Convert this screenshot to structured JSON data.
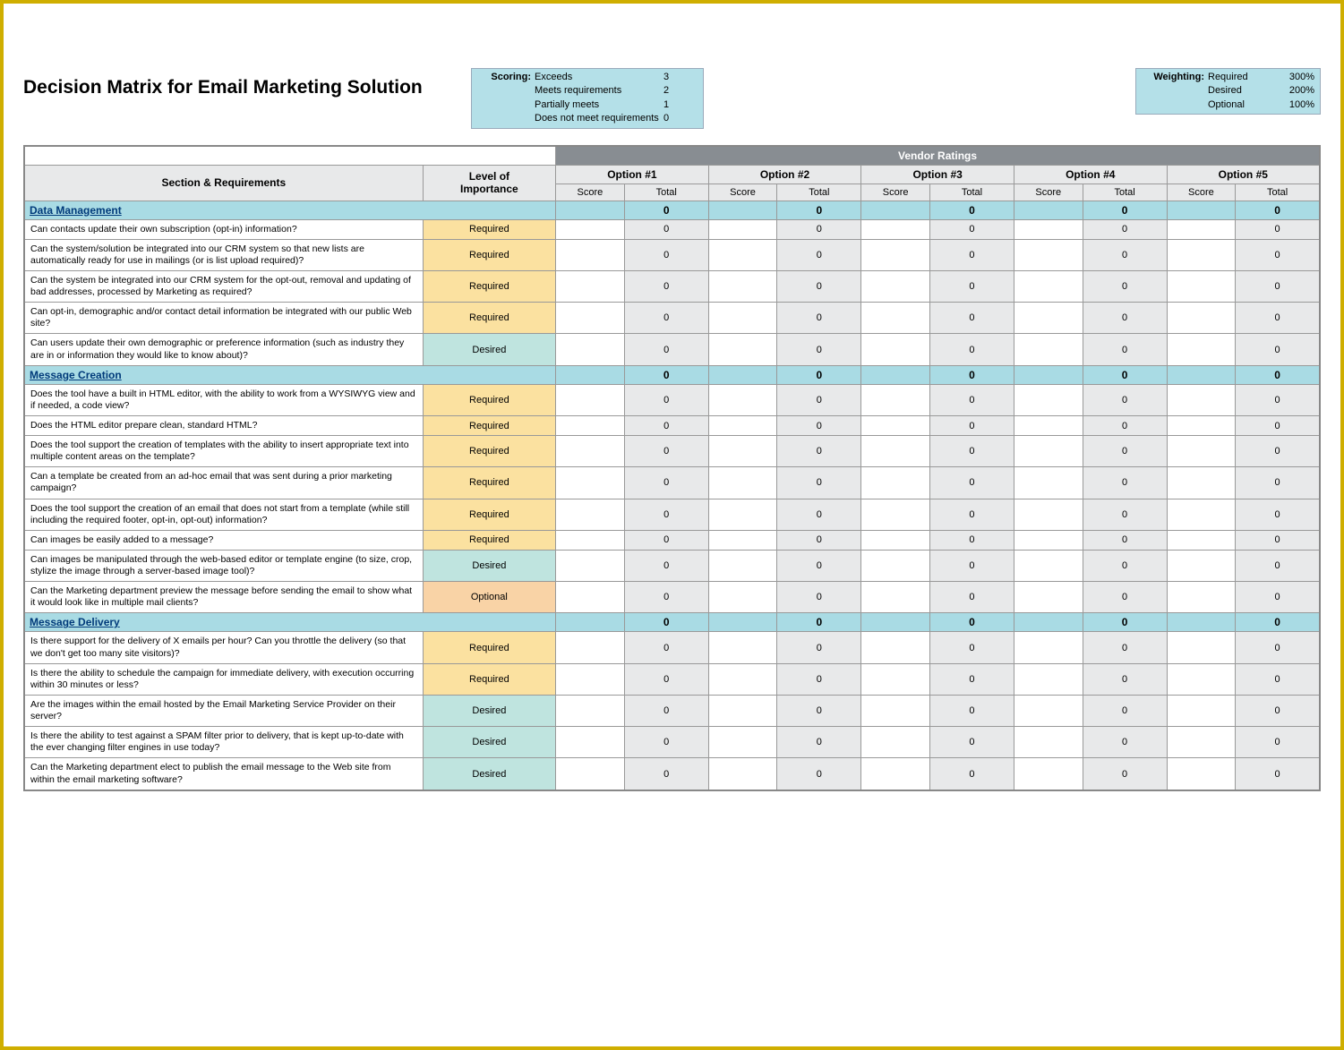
{
  "title": "Decision Matrix for Email Marketing Solution",
  "scoring": {
    "label": "Scoring:",
    "rows": [
      {
        "text": "Exceeds",
        "value": "3"
      },
      {
        "text": "Meets requirements",
        "value": "2"
      },
      {
        "text": "Partially meets",
        "value": "1"
      },
      {
        "text": "Does not meet requirements",
        "value": "0"
      }
    ]
  },
  "weighting": {
    "label": "Weighting:",
    "rows": [
      {
        "text": "Required",
        "value": "300%"
      },
      {
        "text": "Desired",
        "value": "200%"
      },
      {
        "text": "Optional",
        "value": "100%"
      }
    ]
  },
  "headers": {
    "vendor_ratings": "Vendor Ratings",
    "section_requirements": "Section & Requirements",
    "level_of_importance": "Level of\nImportance",
    "options": [
      "Option #1",
      "Option #2",
      "Option #3",
      "Option #4",
      "Option #5"
    ],
    "score": "Score",
    "total": "Total"
  },
  "sections": [
    {
      "name": "Data Management",
      "totals": [
        "0",
        "0",
        "0",
        "0",
        "0"
      ],
      "rows": [
        {
          "text": "Can contacts update their own subscription (opt-in) information?",
          "level": "Required",
          "totals": [
            "0",
            "0",
            "0",
            "0",
            "0"
          ]
        },
        {
          "text": "Can the system/solution be integrated into our CRM system so that new lists are automatically ready for use in mailings (or is list upload required)?",
          "level": "Required",
          "totals": [
            "0",
            "0",
            "0",
            "0",
            "0"
          ]
        },
        {
          "text": "Can the system be integrated into our CRM system for the opt-out, removal and updating of bad addresses, processed by Marketing as required?",
          "level": "Required",
          "totals": [
            "0",
            "0",
            "0",
            "0",
            "0"
          ]
        },
        {
          "text": "Can opt-in, demographic and/or contact detail information be integrated with our public Web site?",
          "level": "Required",
          "totals": [
            "0",
            "0",
            "0",
            "0",
            "0"
          ]
        },
        {
          "text": "Can users update their own demographic or preference information (such as industry they are in or information they would like to know about)?",
          "level": "Desired",
          "totals": [
            "0",
            "0",
            "0",
            "0",
            "0"
          ]
        }
      ]
    },
    {
      "name": "Message Creation",
      "totals": [
        "0",
        "0",
        "0",
        "0",
        "0"
      ],
      "rows": [
        {
          "text": "Does the tool have a built in HTML editor, with the ability to work from a WYSIWYG view and if needed, a code view?",
          "level": "Required",
          "totals": [
            "0",
            "0",
            "0",
            "0",
            "0"
          ]
        },
        {
          "text": "Does the HTML editor prepare clean, standard HTML?",
          "level": "Required",
          "totals": [
            "0",
            "0",
            "0",
            "0",
            "0"
          ]
        },
        {
          "text": "Does the tool support the creation of templates with the ability to insert appropriate text into multiple content areas on the template?",
          "level": "Required",
          "totals": [
            "0",
            "0",
            "0",
            "0",
            "0"
          ]
        },
        {
          "text": "Can a template be created from an ad-hoc email that was sent during a prior marketing campaign?",
          "level": "Required",
          "totals": [
            "0",
            "0",
            "0",
            "0",
            "0"
          ]
        },
        {
          "text": "Does the tool support the creation of an email that does not start from a template (while still including the required footer, opt-in, opt-out) information?",
          "level": "Required",
          "totals": [
            "0",
            "0",
            "0",
            "0",
            "0"
          ]
        },
        {
          "text": "Can images be easily added to a message?",
          "level": "Required",
          "totals": [
            "0",
            "0",
            "0",
            "0",
            "0"
          ]
        },
        {
          "text": "Can images be manipulated through the web-based editor or template engine (to size, crop, stylize the image through a server-based image tool)?",
          "level": "Desired",
          "totals": [
            "0",
            "0",
            "0",
            "0",
            "0"
          ]
        },
        {
          "text": "Can the Marketing department preview the message before sending the email to show what it would look like in multiple mail clients?",
          "level": "Optional",
          "totals": [
            "0",
            "0",
            "0",
            "0",
            "0"
          ]
        }
      ]
    },
    {
      "name": "Message Delivery",
      "totals": [
        "0",
        "0",
        "0",
        "0",
        "0"
      ],
      "rows": [
        {
          "text": "Is there support for the delivery of X emails per hour?  Can you throttle the delivery (so that we don't get too many site visitors)?",
          "level": "Required",
          "totals": [
            "0",
            "0",
            "0",
            "0",
            "0"
          ]
        },
        {
          "text": "Is there the ability to schedule the campaign for immediate delivery, with execution occurring within 30 minutes or less?",
          "level": "Required",
          "totals": [
            "0",
            "0",
            "0",
            "0",
            "0"
          ]
        },
        {
          "text": "Are the images within the email hosted by the Email Marketing Service Provider on their server?",
          "level": "Desired",
          "totals": [
            "0",
            "0",
            "0",
            "0",
            "0"
          ]
        },
        {
          "text": "Is there the ability to test against a SPAM filter prior to delivery, that is kept up-to-date with the ever changing filter engines in use today?",
          "level": "Desired",
          "totals": [
            "0",
            "0",
            "0",
            "0",
            "0"
          ]
        },
        {
          "text": "Can the Marketing department elect to publish the email message to the Web site from within the email marketing software?",
          "level": "Desired",
          "totals": [
            "0",
            "0",
            "0",
            "0",
            "0"
          ]
        }
      ]
    }
  ]
}
